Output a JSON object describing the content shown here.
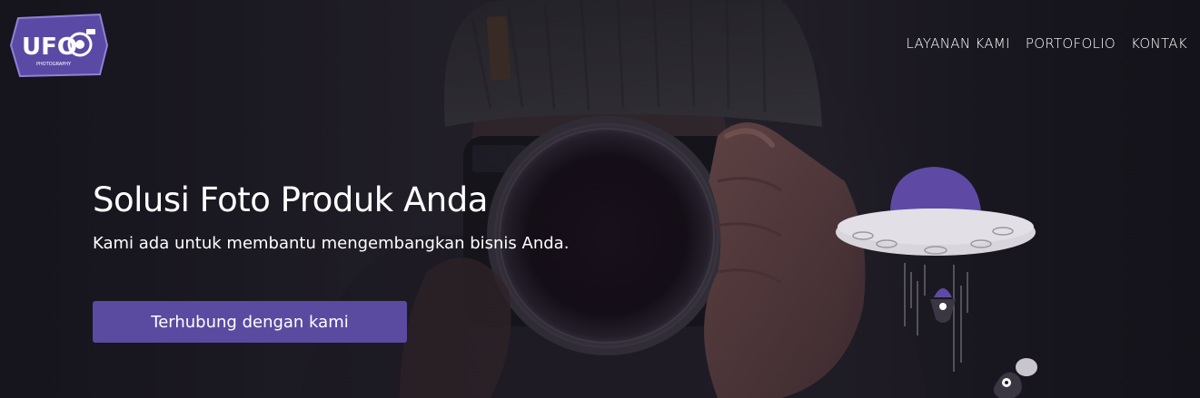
{
  "brand": {
    "logo_letters": "UFO",
    "logo_tagline": "PHOTOGRAPHY",
    "accent_color": "#5a4aa0"
  },
  "nav": {
    "items": [
      {
        "label": "LAYANAN KAMI"
      },
      {
        "label": "PORTOFOLIO"
      },
      {
        "label": "KONTAK"
      }
    ]
  },
  "hero": {
    "headline": "Solusi Foto Produk Anda",
    "subheadline": "Kami ada untuk membantu mengembangkan bisnis Anda.",
    "cta_label": "Terhubung dengan kami"
  },
  "icons": {
    "logo": "camera-hexagon-logo",
    "illustration": "ufo-illustration"
  }
}
